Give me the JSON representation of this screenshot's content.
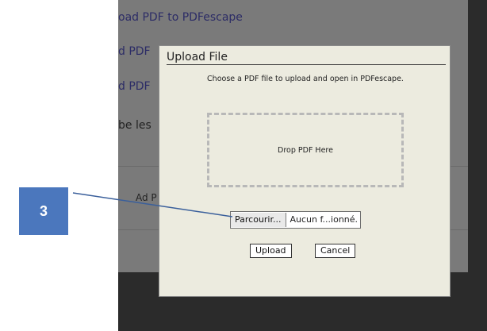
{
  "background_page": {
    "lines": [
      "oad PDF to PDFescape",
      "d PDF",
      "d PDF",
      "be les",
      "Ad P"
    ]
  },
  "modal": {
    "title": "Upload File",
    "instructions": "Choose a PDF file to upload and open in PDFescape.",
    "dropzone_label": "Drop PDF Here",
    "file_input": {
      "browse_label": "Parcourir...",
      "file_name": "Aucun f...ionné."
    },
    "upload_label": "Upload",
    "cancel_label": "Cancel"
  },
  "callout": {
    "number": "3",
    "color": "#4b77bd"
  }
}
